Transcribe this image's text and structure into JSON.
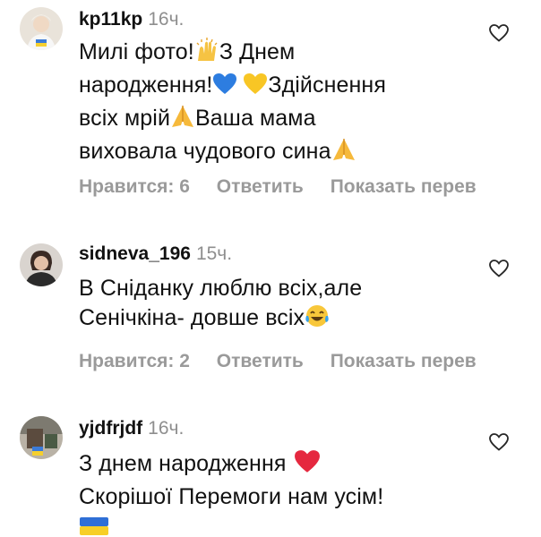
{
  "comments": [
    {
      "username": "kp11kp",
      "time": "16ч.",
      "lines": [
        "Милі фото!",
        "З Днем",
        "народження!",
        "Здійснення",
        "всіх мрій",
        "Ваша мама",
        "виховала чудового сина"
      ],
      "likes_label": "Нравится: 6",
      "reply_label": "Ответить",
      "translate_label": "Показать перев",
      "avatar_icon": "avatar-photo",
      "like_icon": "heart-outline-icon"
    },
    {
      "username": "sidneva_196",
      "time": "15ч.",
      "lines": [
        "В Сніданку люблю всіх,але",
        "Сенічкіна- довше всіх"
      ],
      "likes_label": "Нравится: 2",
      "reply_label": "Ответить",
      "translate_label": "Показать перев",
      "avatar_icon": "avatar-photo",
      "like_icon": "heart-outline-icon"
    },
    {
      "username": "yjdfrjdf",
      "time": "16ч.",
      "lines": [
        "З днем народження",
        "Скорішої Перемоги нам усім!"
      ],
      "avatar_icon": "avatar-photo",
      "like_icon": "heart-outline-icon"
    }
  ],
  "colors": {
    "text": "#111111",
    "muted": "#8e8e8e",
    "action": "#9a9a9a",
    "background": "#ffffff"
  }
}
